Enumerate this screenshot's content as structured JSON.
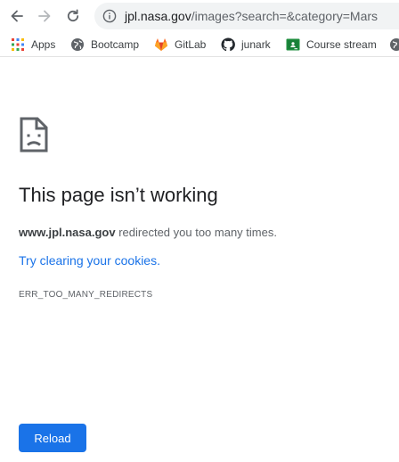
{
  "toolbar": {
    "back_icon": "arrow-left-icon",
    "forward_icon": "arrow-right-icon",
    "reload_icon": "reload-icon",
    "url_host": "jpl.nasa.gov",
    "url_path": "/images?search=&category=Mars"
  },
  "bookmarks": {
    "items": [
      {
        "label": "Apps",
        "icon": "apps-grid-icon"
      },
      {
        "label": "Bootcamp",
        "icon": "globe-icon"
      },
      {
        "label": "GitLab",
        "icon": "gitlab-icon"
      },
      {
        "label": "junark",
        "icon": "github-icon"
      },
      {
        "label": "Course stream",
        "icon": "classroom-icon"
      }
    ]
  },
  "error": {
    "title": "This page isn’t working",
    "domain": "www.jpl.nasa.gov",
    "message": " redirected you too many times.",
    "link_text": "Try clearing your cookies",
    "link_suffix": ".",
    "code": "ERR_TOO_MANY_REDIRECTS",
    "reload_label": "Reload"
  },
  "colors": {
    "accent": "#1a73e8",
    "text_primary": "#202124",
    "text_secondary": "#5f6368"
  }
}
